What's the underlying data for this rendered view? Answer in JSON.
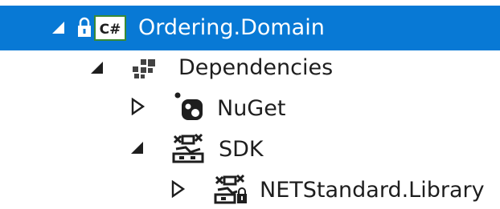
{
  "colors": {
    "selection": "#0879d5",
    "text": "#1e1e1e",
    "selected_text": "#ffffff",
    "icon": "#424242",
    "csharp_badge": "#388a34"
  },
  "tree": {
    "project": {
      "label": "Ordering.Domain",
      "toggle": "expanded",
      "lock_icon": "lock-icon",
      "project_icon": "csharp-project-icon",
      "badge_text": "C#"
    },
    "dependencies": {
      "label": "Dependencies",
      "toggle": "expanded",
      "icon": "dependencies-icon"
    },
    "nuget": {
      "label": "NuGet",
      "toggle": "collapsed",
      "icon": "nuget-icon"
    },
    "sdk": {
      "label": "SDK",
      "toggle": "expanded",
      "icon": "sdk-icon"
    },
    "netstandard": {
      "label": "NETStandard.Library",
      "toggle": "collapsed",
      "icon": "sdk-package-icon"
    }
  }
}
